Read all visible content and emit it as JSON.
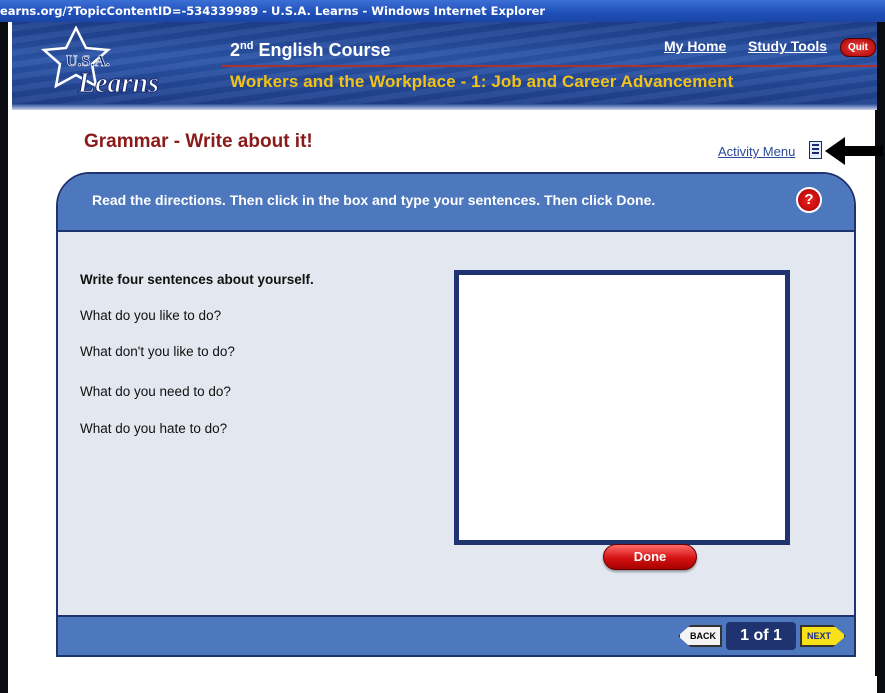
{
  "window": {
    "title": "earns.org/?TopicContentID=-534339989 - U.S.A. Learns - Windows Internet Explorer"
  },
  "header": {
    "logo_text": "U.S.A. Learns",
    "course_title_num": "2",
    "course_title_sup": "nd",
    "course_title_rest": " English Course",
    "unit_title": "Workers and the Workplace - 1: Job and Career Advancement",
    "my_home": "My Home",
    "study_tools": "Study Tools",
    "quit": "Quit"
  },
  "activity": {
    "title": "Grammar - Write about it!",
    "menu_label": "Activity Menu",
    "directions": "Read the directions. Then click in the box and type your sentences. Then click Done.",
    "help": "?",
    "prompts": [
      "Write four sentences about yourself.",
      "What do you like to do?",
      "What don't you like to do?",
      "What do you need to do?",
      "What do you hate to do?"
    ],
    "answer_value": "",
    "done_label": "Done"
  },
  "nav": {
    "back_label": "BACK",
    "page_count": "1 of 1",
    "next_label": "NEXT"
  },
  "colors": {
    "brand_blue": "#1f3370",
    "panel_blue": "#4d78bd",
    "title_red": "#8b1a1a",
    "unit_gold": "#f2c316"
  },
  "icons": [
    "activity-menu-icon",
    "pointer-arrow-icon",
    "help-icon"
  ]
}
